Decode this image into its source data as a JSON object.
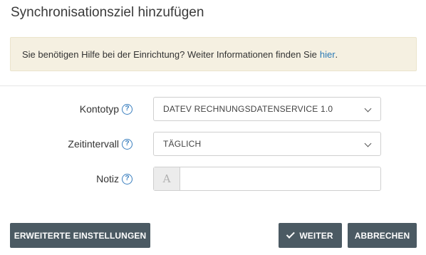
{
  "dialog": {
    "title": "Synchronisationsziel hinzufügen"
  },
  "hint": {
    "text": "Sie benötigen Hilfe bei der Einrichtung? Weiter Informationen finden Sie",
    "link_text": "hier",
    "suffix": "."
  },
  "form": {
    "account_type": {
      "label": "Kontotyp",
      "value": "DATEV RECHNUNGSDATENSERVICE 1.0"
    },
    "interval": {
      "label": "Zeitintervall",
      "value": "TÄGLICH"
    },
    "note": {
      "label": "Notiz",
      "addon_glyph": "A",
      "value": ""
    },
    "help_glyph": "?"
  },
  "buttons": {
    "advanced": "ERWEITERTE EINSTELLUNGEN",
    "next": "WEITER",
    "cancel": "ABBRECHEN"
  },
  "icons": {
    "help": "question-circle-icon",
    "dropdown": "chevron-down-icon",
    "text_addon": "font-icon",
    "confirm": "check-icon"
  },
  "colors": {
    "button_bg": "#4b5a63",
    "hint_bg": "#f5f0e1",
    "link": "#2a7ab6",
    "help_icon": "#3a7fbf"
  }
}
